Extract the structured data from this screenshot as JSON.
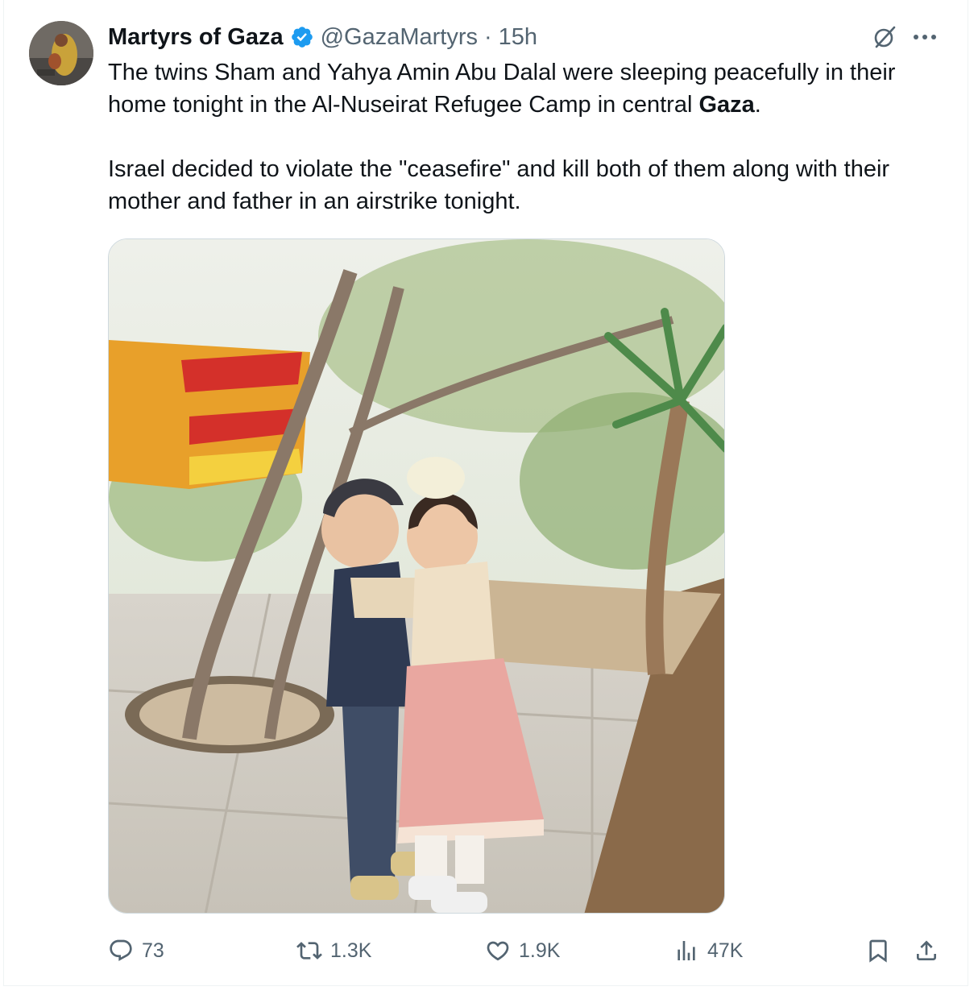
{
  "tweet": {
    "author_name": "Martyrs of Gaza",
    "handle": "@GazaMartyrs",
    "separator": "·",
    "time": "15h",
    "icons": {
      "verified": "verified-badge-icon",
      "grok": "grok-icon",
      "more": "more-icon"
    },
    "text": {
      "para1_start": "The twins Sham and Yahya Amin Abu Dalal were sleeping peacefully in their home tonight in the Al-Nuseirat Refugee Camp in central ",
      "para1_bold": "Gaza",
      "para1_end": ".",
      "para2": "Israel decided to violate the \"ceasefire\" and kill both of them along with their mother and father in an airstrike tonight."
    },
    "media": {
      "description": "photo-of-two-children-hugging"
    },
    "actions": {
      "replies": "73",
      "reposts": "1.3K",
      "likes": "1.9K",
      "views": "47K"
    },
    "colors": {
      "text": "#0f1419",
      "secondary": "#536471",
      "verified": "#1d9bf0",
      "border": "#eff3f4"
    }
  }
}
